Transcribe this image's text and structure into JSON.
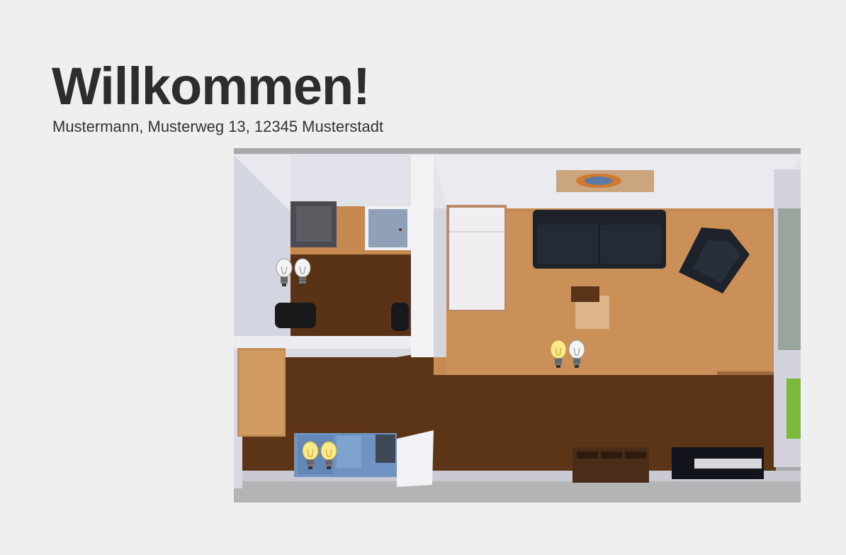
{
  "header": {
    "title": "Willkommen!",
    "address": "Mustermann, Musterweg 13, 12345 Musterstadt"
  },
  "floorplan": {
    "lamps": [
      {
        "name": "lamp-bathroom-1",
        "on": false
      },
      {
        "name": "lamp-bathroom-2",
        "on": false
      },
      {
        "name": "lamp-living-1",
        "on": true
      },
      {
        "name": "lamp-living-2",
        "on": false
      },
      {
        "name": "lamp-kitchen-1",
        "on": true
      },
      {
        "name": "lamp-kitchen-2",
        "on": true
      }
    ],
    "colors": {
      "lamp_on": "#fbe98a",
      "lamp_off": "#f4f4f4",
      "floor_light": "#c78f57",
      "floor_dark": "#5a3416",
      "wall": "#e4e5ec"
    }
  }
}
